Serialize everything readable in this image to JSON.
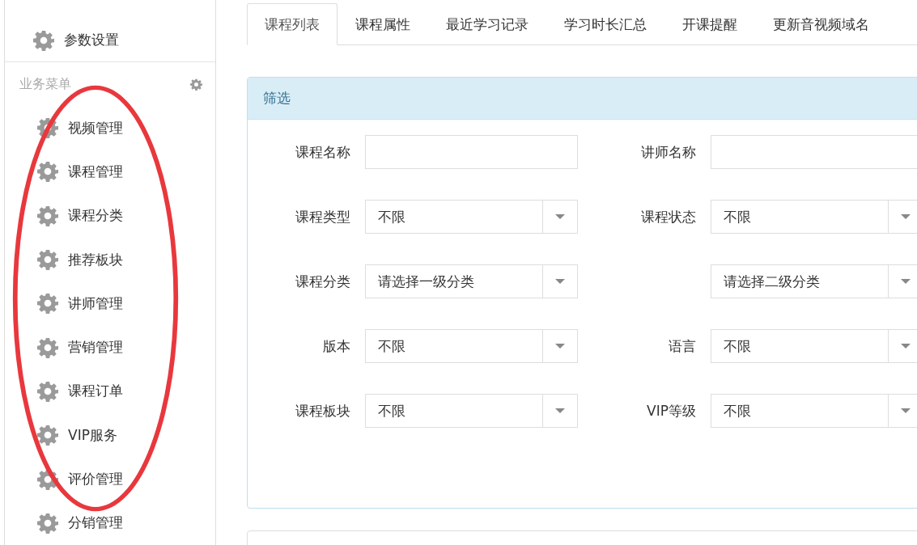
{
  "sidebar": {
    "top_items": [
      {
        "label": "参数设置"
      }
    ],
    "section": {
      "title": "业务菜单",
      "items": [
        {
          "label": "视频管理"
        },
        {
          "label": "课程管理"
        },
        {
          "label": "课程分类"
        },
        {
          "label": "推荐板块"
        },
        {
          "label": "讲师管理"
        },
        {
          "label": "营销管理"
        },
        {
          "label": "课程订单"
        },
        {
          "label": "VIP服务"
        },
        {
          "label": "评价管理"
        },
        {
          "label": "分销管理"
        }
      ]
    }
  },
  "tabs": [
    {
      "label": "课程列表",
      "selected": true
    },
    {
      "label": "课程属性",
      "selected": false
    },
    {
      "label": "最近学习记录",
      "selected": false
    },
    {
      "label": "学习时长汇总",
      "selected": false
    },
    {
      "label": "开课提醒",
      "selected": false
    },
    {
      "label": "更新音视频域名",
      "selected": false
    }
  ],
  "filter_panel": {
    "title": "筛选",
    "rows": [
      [
        {
          "kind": "text",
          "label": "课程名称"
        },
        {
          "kind": "text",
          "label": "讲师名称"
        }
      ],
      [
        {
          "kind": "select",
          "label": "课程类型",
          "value": "不限"
        },
        {
          "kind": "select",
          "label": "课程状态",
          "value": "不限"
        }
      ],
      [
        {
          "kind": "select",
          "label": "课程分类",
          "value": "请选择一级分类"
        },
        {
          "kind": "select",
          "value": "请选择二级分类"
        }
      ],
      [
        {
          "kind": "select",
          "label": "版本",
          "value": "不限"
        },
        {
          "kind": "select",
          "label": "语言",
          "value": "不限"
        }
      ],
      [
        {
          "kind": "select",
          "label": "课程板块",
          "value": "不限"
        },
        {
          "kind": "select",
          "label": "VIP等级",
          "value": "不限"
        }
      ]
    ]
  },
  "annotation": {
    "kind": "ellipse"
  }
}
